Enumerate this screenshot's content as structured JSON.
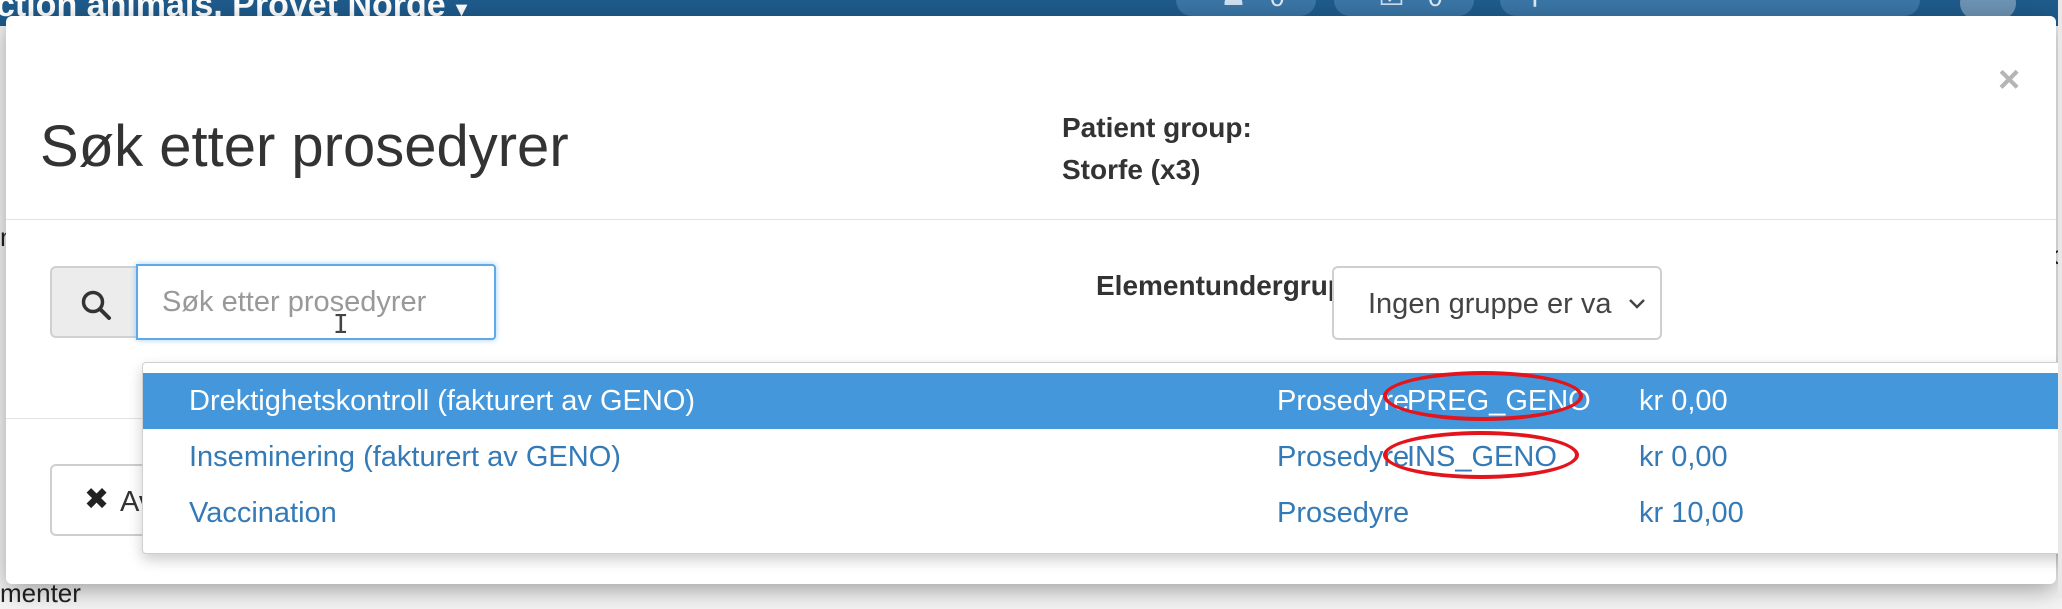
{
  "app_header": {
    "title": "ction animals, Provet Norde",
    "counters": [
      {
        "icon": "bell-icon",
        "value": "0"
      },
      {
        "icon": "checkbox-icon",
        "value": "0"
      }
    ],
    "search_icon": "search-icon"
  },
  "background_text": {
    "left_fragment": "m",
    "right_fragment_1": "c",
    "right_fragment_2": "e",
    "bottom_fragment": "menter"
  },
  "modal": {
    "title": "Søk etter prosedyrer",
    "close_glyph": "×",
    "patient_group_label": "Patient group:",
    "patient_group_value": "Storfe (x3)",
    "search": {
      "icon": "search-icon",
      "placeholder": "Søk etter prosedyrer",
      "value": ""
    },
    "subgroup": {
      "label": "Elementundergruppe",
      "selected": "Ingen gruppe er va"
    },
    "cancel_button": {
      "icon": "close-icon",
      "label": "Av"
    },
    "results": [
      {
        "name": "Drektighetskontroll (fakturert av GENO)",
        "type": "Prosedyre",
        "code": "PREG_GENO",
        "price": "kr 0,00",
        "active": true
      },
      {
        "name": "Inseminering (fakturert av GENO)",
        "type": "Prosedyre",
        "code": "INS_GENO",
        "price": "kr 0,00",
        "active": false
      },
      {
        "name": "Vaccination",
        "type": "Prosedyre",
        "code": "",
        "price": "kr 10,00",
        "active": false
      }
    ]
  },
  "colors": {
    "header_bg": "#1f5b8c",
    "active_row": "#4497da",
    "link": "#337ab7",
    "annotation": "#e3141b"
  }
}
